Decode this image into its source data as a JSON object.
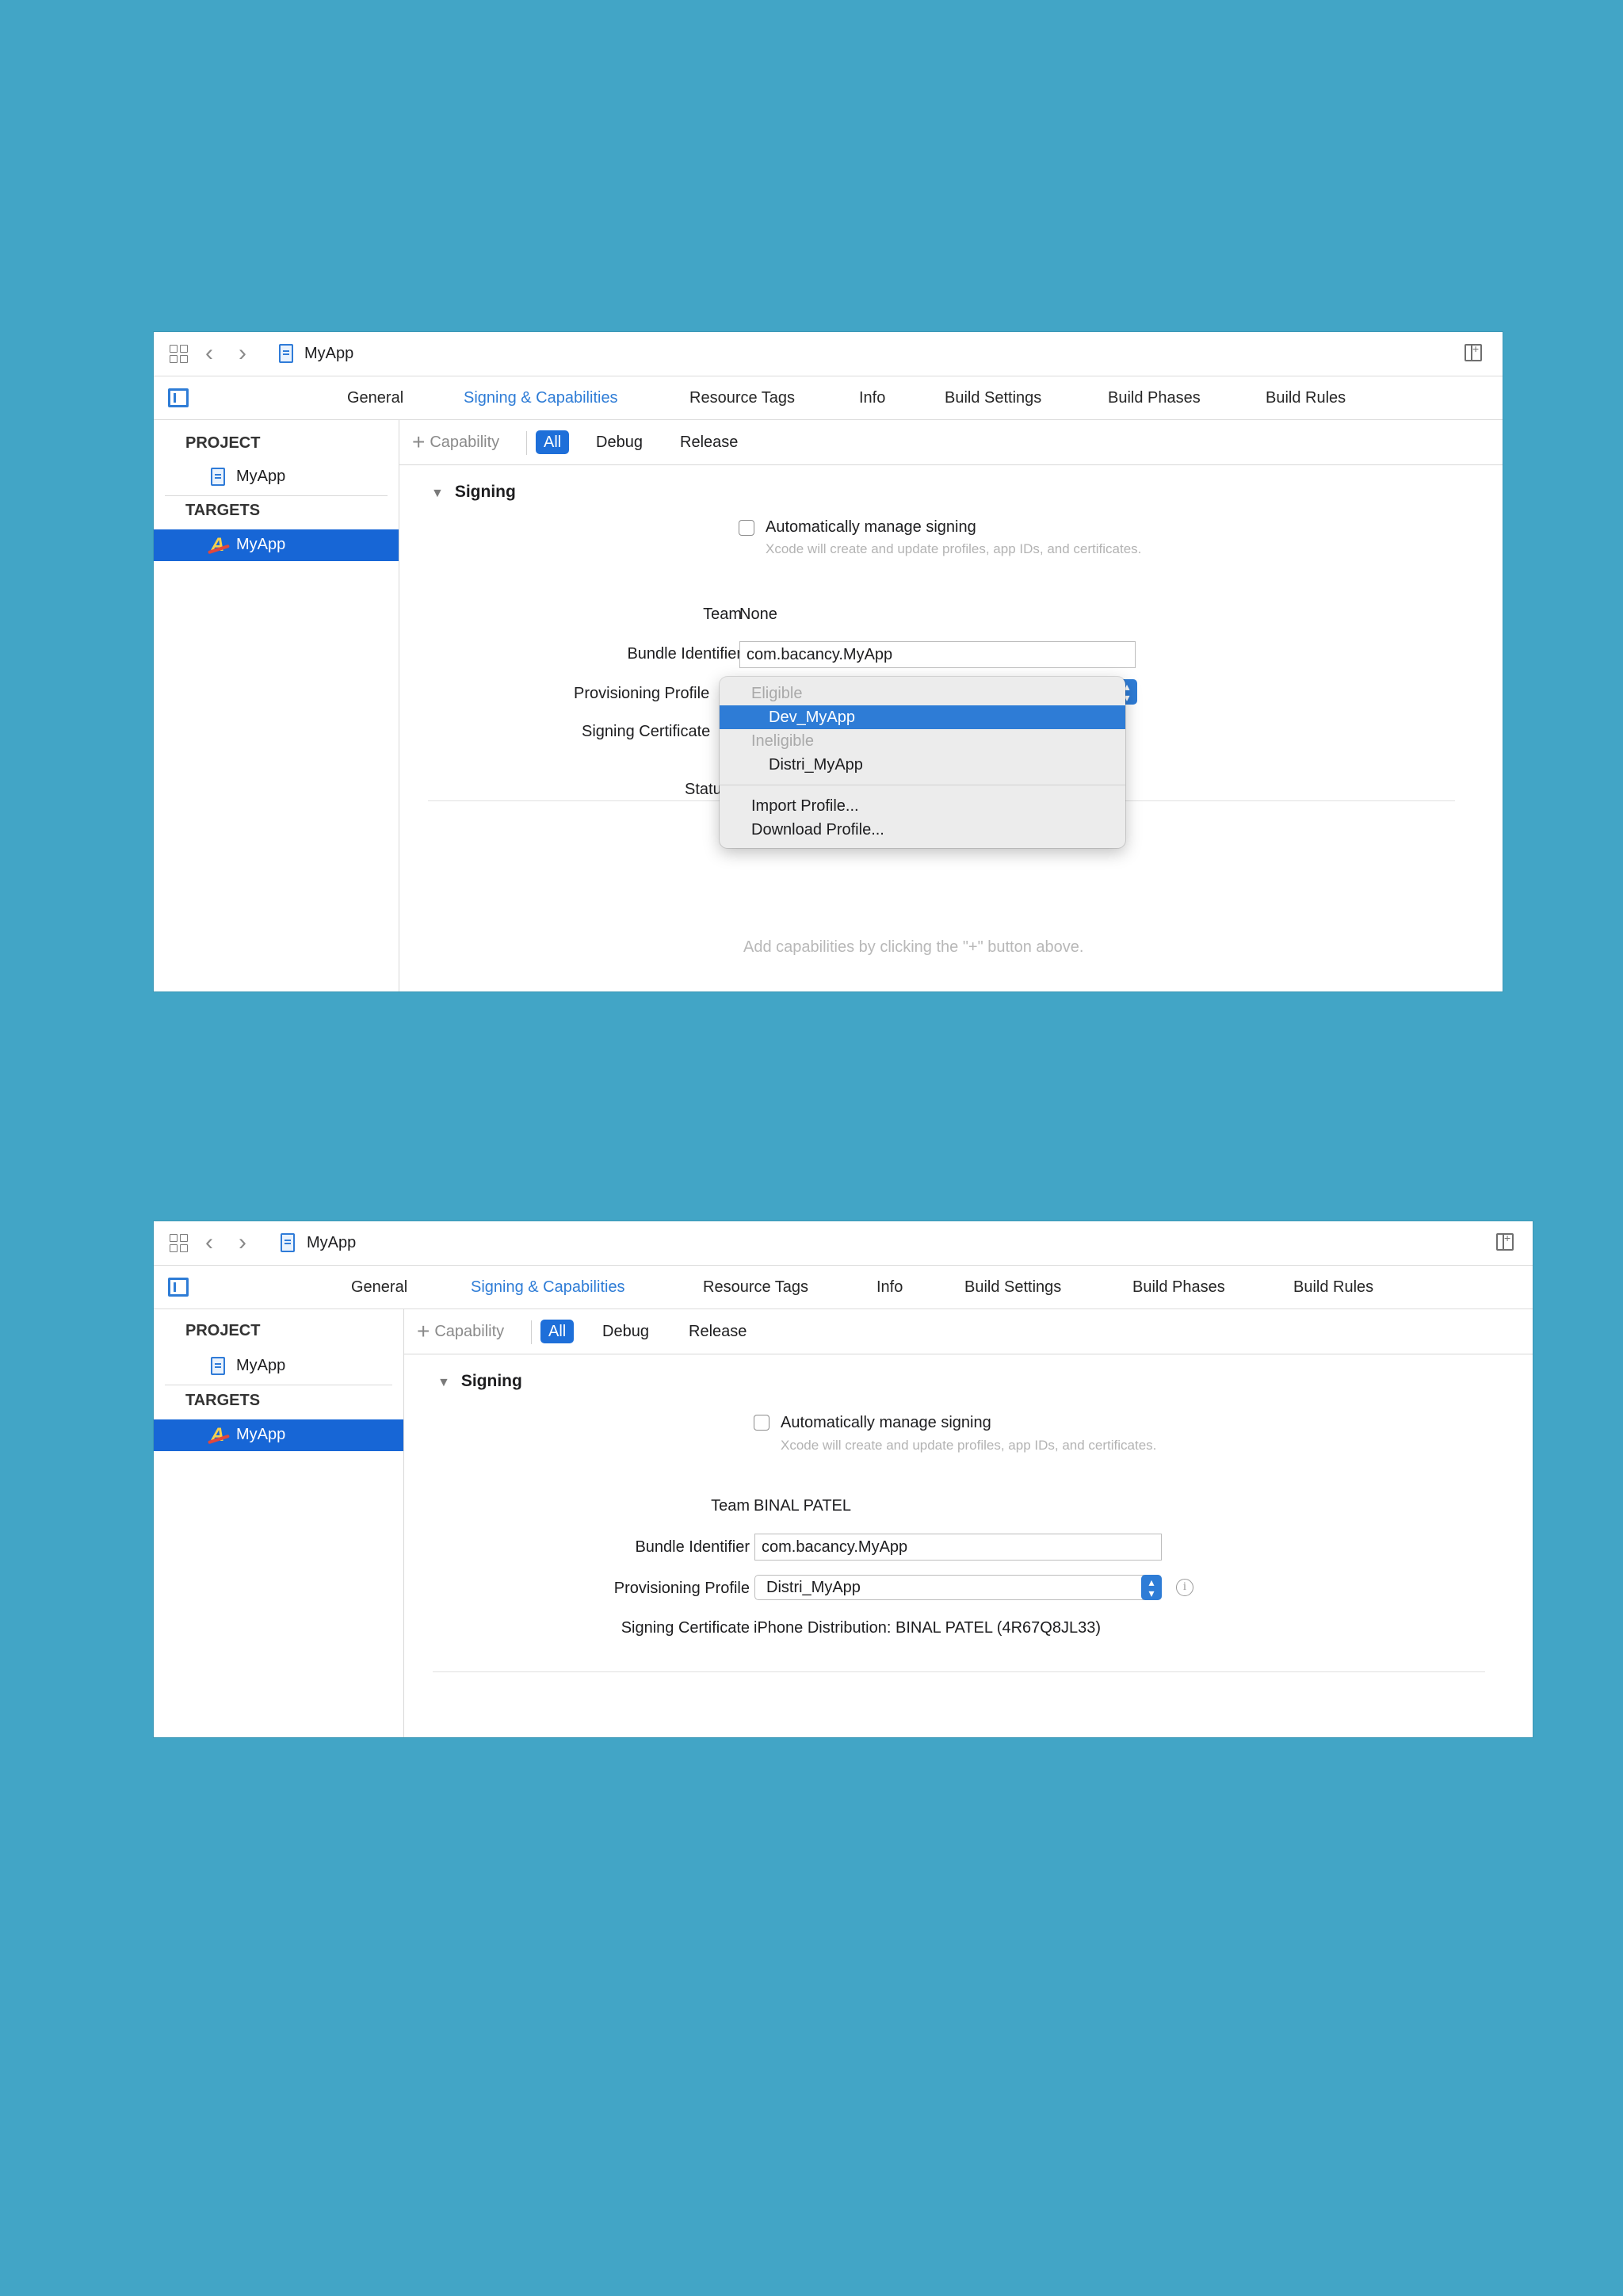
{
  "window1": {
    "toolbar": {
      "title": "MyApp"
    },
    "tabs": [
      "General",
      "Signing & Capabilities",
      "Resource Tags",
      "Info",
      "Build Settings",
      "Build Phases",
      "Build Rules"
    ],
    "sidebar": {
      "project_header": "PROJECT",
      "project_item": "MyApp",
      "targets_header": "TARGETS",
      "target_item": "MyApp"
    },
    "filter": {
      "capability": "Capability",
      "all": "All",
      "debug": "Debug",
      "release": "Release"
    },
    "signing": {
      "title": "Signing",
      "auto_manage": "Automatically manage signing",
      "auto_help": "Xcode will create and update profiles, app IDs, and certificates.",
      "team_label": "Team",
      "team_value": "None",
      "bundle_label": "Bundle Identifier",
      "bundle_value": "com.bacancy.MyApp",
      "profile_label": "Provisioning Profile",
      "cert_label": "Signing Certificate",
      "status_label": "Status"
    },
    "menu": {
      "eligible_header": "Eligible",
      "eligible_item": "Dev_MyApp",
      "ineligible_header": "Ineligible",
      "ineligible_item": "Distri_MyApp",
      "import": "Import Profile...",
      "download": "Download Profile..."
    },
    "empty_hint": "Add capabilities by clicking the \"+\" button above."
  },
  "window2": {
    "toolbar": {
      "title": "MyApp"
    },
    "tabs": [
      "General",
      "Signing & Capabilities",
      "Resource Tags",
      "Info",
      "Build Settings",
      "Build Phases",
      "Build Rules"
    ],
    "sidebar": {
      "project_header": "PROJECT",
      "project_item": "MyApp",
      "targets_header": "TARGETS",
      "target_item": "MyApp"
    },
    "filter": {
      "capability": "Capability",
      "all": "All",
      "debug": "Debug",
      "release": "Release"
    },
    "signing": {
      "title": "Signing",
      "auto_manage": "Automatically manage signing",
      "auto_help": "Xcode will create and update profiles, app IDs, and certificates.",
      "team_label": "Team",
      "team_value": "BINAL PATEL",
      "bundle_label": "Bundle Identifier",
      "bundle_value": "com.bacancy.MyApp",
      "profile_label": "Provisioning Profile",
      "profile_value": "Distri_MyApp",
      "cert_label": "Signing Certificate",
      "cert_value": "iPhone Distribution: BINAL PATEL (4R67Q8JL33)"
    }
  },
  "colors": {
    "background": "#42a5c6",
    "accent": "#2e7cd6",
    "selection": "#1766d6"
  }
}
